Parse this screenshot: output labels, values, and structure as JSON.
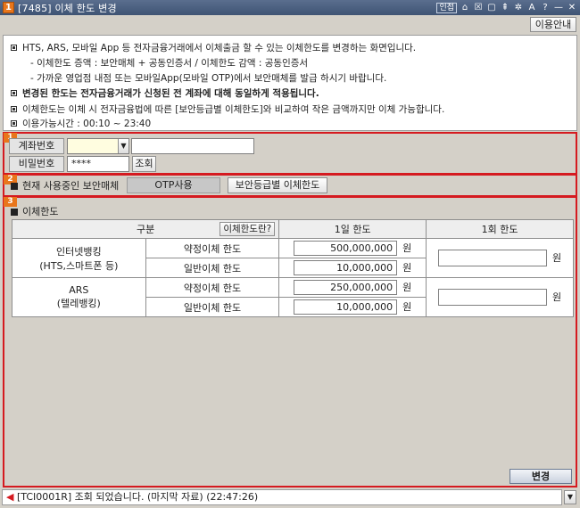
{
  "window": {
    "app_icon": "1",
    "title": "[7485] 이체 한도 변경",
    "tools": [
      "인접",
      "⌂",
      "☒",
      "▢",
      "⇞",
      "✲",
      "A",
      "?",
      "—",
      "✕"
    ]
  },
  "guide_button": "이용안내",
  "info": {
    "line1": "HTS, ARS, 모바일 App 등 전자금융거래에서 이체출금 할 수 있는 이체한도를 변경하는 화면입니다.",
    "line2": "- 이체한도 증액 : 보안매체 + 공동인증서 / 이체한도 감액 : 공동인증서",
    "line3": "- 가까운 영업점 내점 또는 모바일App(모바일 OTP)에서 보안매체를 발급 하시기 바랍니다.",
    "line4": "변경된 한도는 전자금융거래가 신청된 전 계좌에 대해 동일하게 적용됩니다.",
    "line5": "이체한도는 이체 시 전자금융법에 따른 [보안등급별 이체한도]와 비교하여 작은 금액까지만 이체 가능합니다.",
    "line6": "이용가능시간 : 00:10 ~ 23:40"
  },
  "section_numbers": [
    "1",
    "2",
    "3"
  ],
  "account": {
    "account_label": "계좌번호",
    "account_value": "",
    "account_name": "",
    "password_label": "비밀번호",
    "password_value": "****",
    "query_button": "조회"
  },
  "security": {
    "label": "현재 사용중인 보안매체",
    "medium": "OTP사용",
    "grade_button": "보안등급별 이체한도"
  },
  "limit": {
    "heading": "이체한도",
    "headers": {
      "category": "구분",
      "whatis_button": "이체한도란?",
      "daily": "1일 한도",
      "once": "1회 한도"
    },
    "rows": [
      {
        "group": "인터넷뱅킹",
        "group_sub": "(HTS,스마트폰 등)",
        "items": [
          {
            "type": "약정이체 한도",
            "daily": "500,000,000",
            "unit": "원"
          },
          {
            "type": "일반이체 한도",
            "daily": "10,000,000",
            "unit": "원"
          }
        ],
        "once_value": "",
        "once_unit": "원"
      },
      {
        "group": "ARS",
        "group_sub": "(텔레뱅킹)",
        "items": [
          {
            "type": "약정이체 한도",
            "daily": "250,000,000",
            "unit": "원"
          },
          {
            "type": "일반이체 한도",
            "daily": "10,000,000",
            "unit": "원"
          }
        ],
        "once_value": "",
        "once_unit": "원"
      }
    ]
  },
  "change_button": "변경",
  "status": {
    "icon": "speaker-icon",
    "text": "[TCI0001R] 조회 되었습니다. (마지막 자료) (22:47:26)"
  },
  "colors": {
    "section_border": "#d51a20",
    "section_badge": "#e8761c",
    "titlebar": "#3f5474"
  }
}
